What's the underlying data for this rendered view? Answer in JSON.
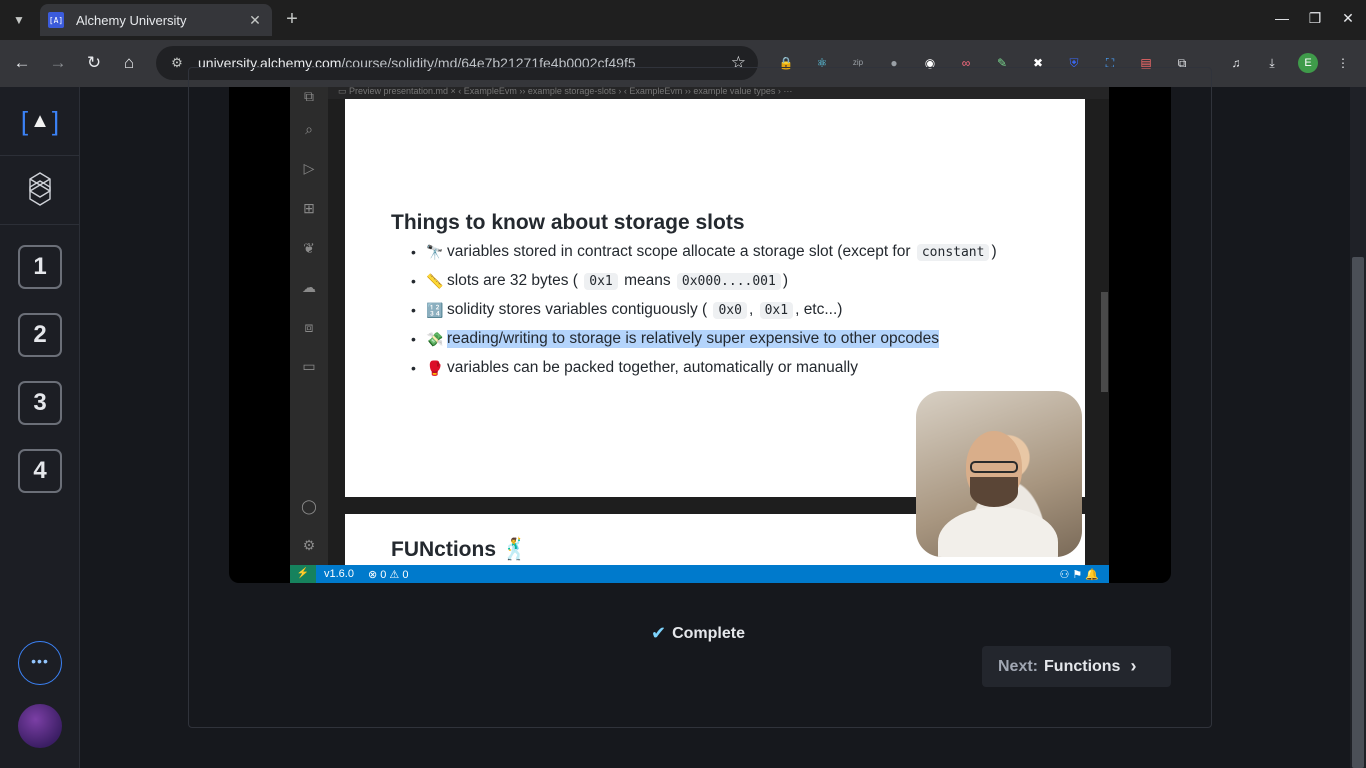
{
  "browser": {
    "tab_title": "Alchemy University",
    "tab_favicon": "[A]",
    "url_host": "university.alchemy.com",
    "url_path": "/course/solidity/md/64e7b21271fe4b0002cf49f5",
    "profile_initial": "E",
    "extensions": [
      "lock-icon",
      "react-icon",
      "gitzip-icon",
      "gray-icon",
      "circle-icon",
      "spy-icon",
      "feather-icon",
      "square-icon",
      "shield-icon",
      "screenshot-icon",
      "note-icon",
      "puzzle-icon"
    ]
  },
  "sidebar": {
    "logo_left": "[",
    "logo_mark": "▲",
    "logo_right": "]",
    "steps": [
      "1",
      "2",
      "3",
      "4"
    ],
    "more_label": "•••"
  },
  "video": {
    "vscode_tabs": "▭ Preview presentation.md ×    ‹ ExampleEvm ›› example storage-slots ›    ‹ ExampleEvm ›› example value types ›    ⋯",
    "slide_title": "Things to know about storage slots",
    "bullets": {
      "b1": {
        "emoji": "🔭",
        "pre": "variables stored in contract scope allocate a storage slot (except for",
        "code": "constant",
        "post": ")"
      },
      "b2": {
        "emoji": "📏",
        "pre": "slots are 32 bytes (",
        "code1": "0x1",
        "mid": "means",
        "code2": "0x000....001",
        "post": ")"
      },
      "b3": {
        "emoji": "🔢",
        "pre": "solidity stores variables contiguously (",
        "code1": "0x0",
        "sep": ",",
        "code2": "0x1",
        "post": ", etc...)"
      },
      "b4": {
        "emoji": "💸",
        "text": "reading/writing to storage is relatively super expensive to other opcodes"
      },
      "b5": {
        "emoji": "🥊",
        "text": "variables can be packed together, automatically or manually"
      }
    },
    "next_slide_title": "FUNctions 🕺",
    "status_version": "v1.6.0",
    "status_errors": "⊗ 0 ⚠ 0"
  },
  "lesson": {
    "complete_label": "Complete",
    "next_prefix": "Next:",
    "next_title": "Functions"
  },
  "colors": {
    "accent": "#3b82f6",
    "check": "#7dd3fc",
    "highlight": "#b4d4fb",
    "vscode_status": "#007acc"
  }
}
